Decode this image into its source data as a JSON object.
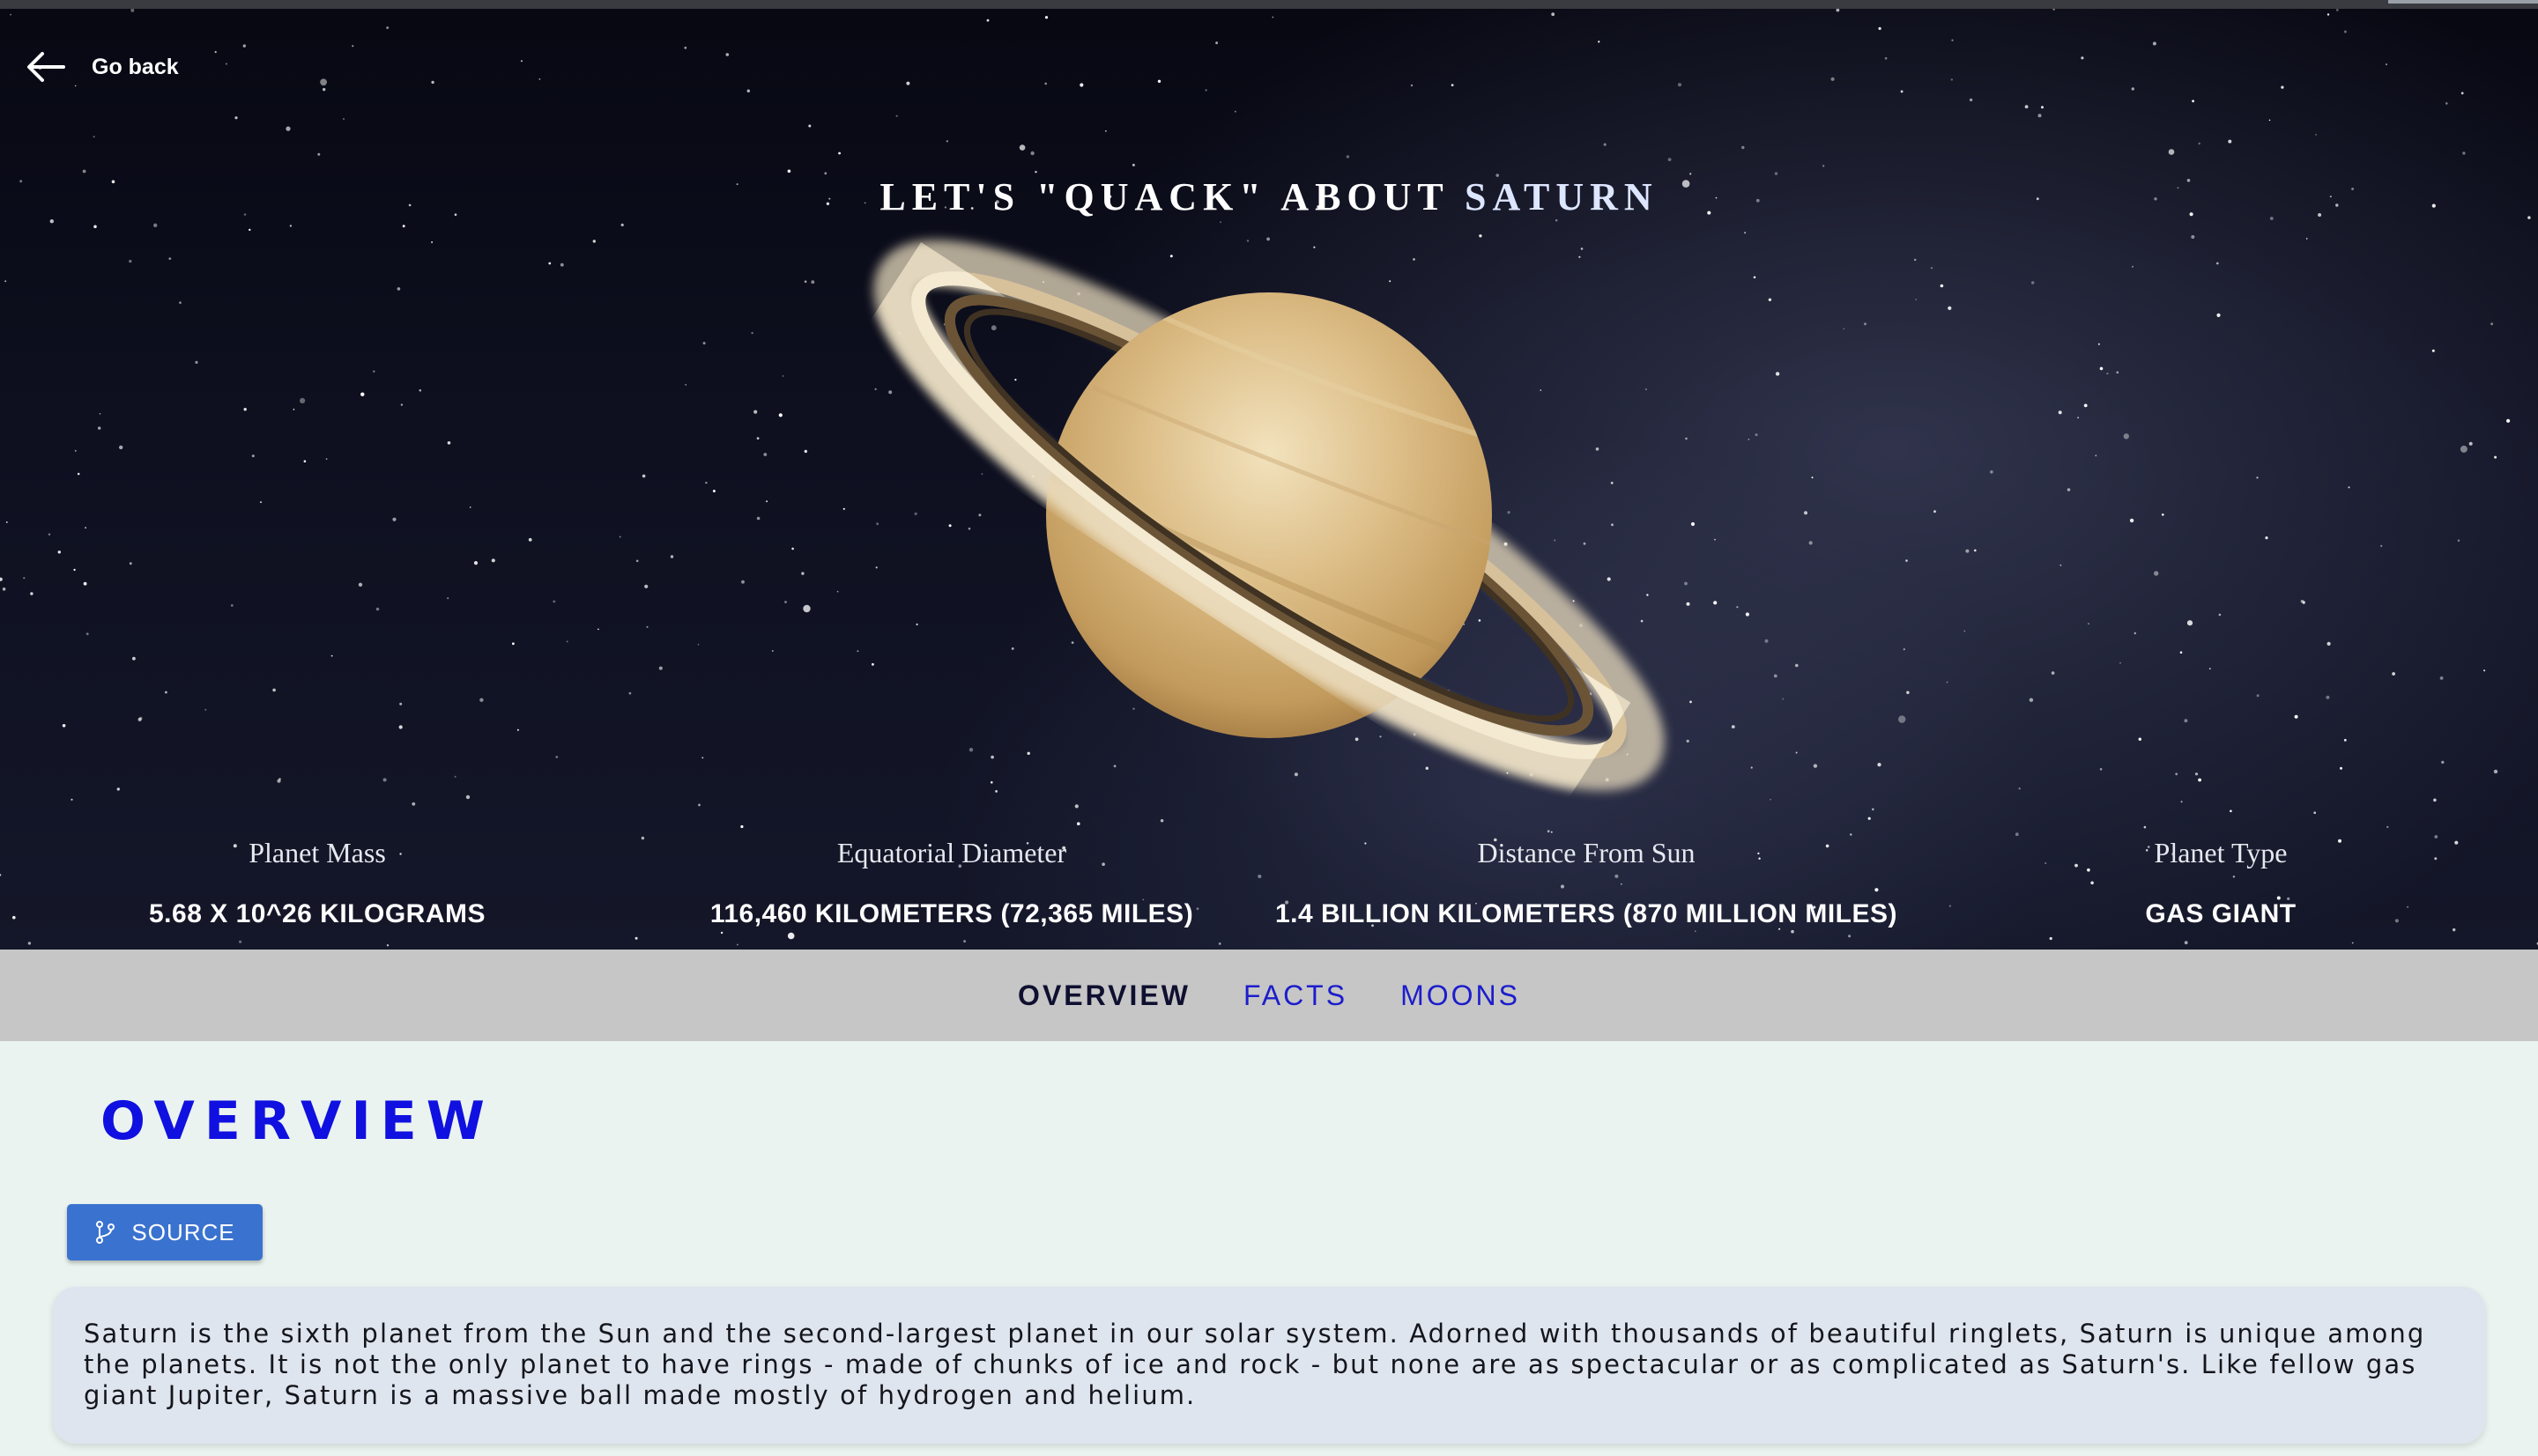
{
  "nav": {
    "back_label": "Go back",
    "back_icon": "arrow-left-icon"
  },
  "hero": {
    "title_prefix": "LET'S \"QUACK\" ABOUT",
    "title_planet": "SATURN"
  },
  "stats": [
    {
      "label": "Planet Mass",
      "value": "5.68 X 10^26 KILOGRAMS"
    },
    {
      "label": "Equatorial Diameter",
      "value": "116,460 KILOMETERS (72,365 MILES)"
    },
    {
      "label": "Distance From Sun",
      "value": "1.4 BILLION KILOMETERS (870 MILLION MILES)"
    },
    {
      "label": "Planet Type",
      "value": "GAS GIANT"
    }
  ],
  "tabs": [
    {
      "label": "OVERVIEW",
      "active": true
    },
    {
      "label": "FACTS",
      "active": false
    },
    {
      "label": "MOONS",
      "active": false
    }
  ],
  "overview": {
    "heading": "OVERVIEW",
    "source_label": "SOURCE",
    "source_icon": "git-branch-icon",
    "text": "Saturn is the sixth planet from the Sun and the second-largest planet in our solar system. Adorned with thousands of beautiful ringlets, Saturn is unique among the planets. It is not the only planet to have rings - made of chunks of ice and rock - but none are as spectacular or as complicated as Saturn's. Like fellow gas giant Jupiter, Saturn is a massive ball made mostly of hydrogen and helium."
  },
  "colors": {
    "tab_active": "#0f1030",
    "tab_inactive": "#1c1dcc",
    "heading": "#1010e0",
    "source_button": "#3a72cf",
    "tab_bar": "#c6c6c6",
    "page_bg": "#eaf3ef",
    "card_bg": "#dfe5ef"
  }
}
